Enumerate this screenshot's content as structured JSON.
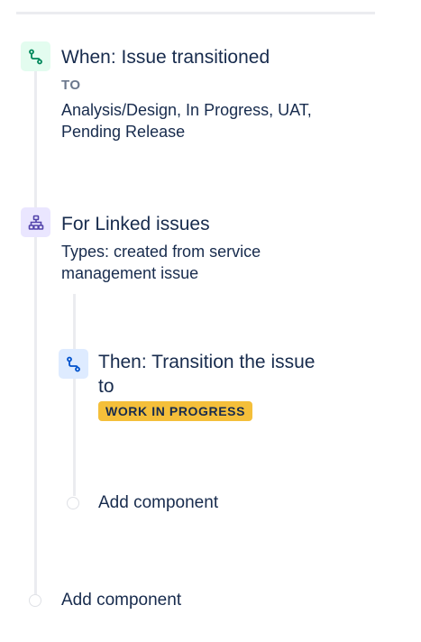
{
  "trigger": {
    "icon": "transition-icon",
    "title": "When: Issue transitioned",
    "to_label": "TO",
    "statuses_line1": "Analysis/Design, In Progress, UAT,",
    "statuses_line2": "Pending Release"
  },
  "branch": {
    "icon": "hierarchy-icon",
    "title": "For Linked issues",
    "types_line1": "Types: created from service",
    "types_line2": "management issue"
  },
  "action": {
    "icon": "transition-icon",
    "title_line1": "Then: Transition the issue",
    "title_line2": "to",
    "status_lozenge": "WORK IN PROGRESS",
    "lozenge_color": "#f4bf3a"
  },
  "add_component_inner": "Add component",
  "add_component_outer": "Add component",
  "colors": {
    "trigger_icon_bg": "#e3fcef",
    "trigger_icon_fg": "#00875A",
    "branch_icon_bg": "#eae6ff",
    "branch_icon_fg": "#5243AA",
    "action_icon_bg": "#deebff",
    "action_icon_fg": "#0052CC",
    "text": "#172B4D"
  }
}
